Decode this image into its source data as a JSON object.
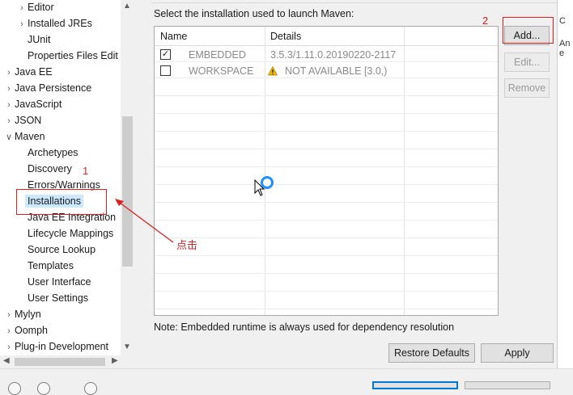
{
  "tree": {
    "items": [
      {
        "label": "Editor",
        "level": 1,
        "chevron": ">"
      },
      {
        "label": "Installed JREs",
        "level": 1,
        "chevron": ">"
      },
      {
        "label": "JUnit",
        "level": 1,
        "chevron": ""
      },
      {
        "label": "Properties Files Edit",
        "level": 1,
        "chevron": ""
      },
      {
        "label": "Java EE",
        "level": 0,
        "chevron": ">"
      },
      {
        "label": "Java Persistence",
        "level": 0,
        "chevron": ">"
      },
      {
        "label": "JavaScript",
        "level": 0,
        "chevron": ">"
      },
      {
        "label": "JSON",
        "level": 0,
        "chevron": ">"
      },
      {
        "label": "Maven",
        "level": 0,
        "chevron": "v"
      },
      {
        "label": "Archetypes",
        "level": 1,
        "chevron": ""
      },
      {
        "label": "Discovery",
        "level": 1,
        "chevron": ""
      },
      {
        "label": "Errors/Warnings",
        "level": 1,
        "chevron": ""
      },
      {
        "label": "Installations",
        "level": 1,
        "chevron": "",
        "selected": true
      },
      {
        "label": "Java EE Integration",
        "level": 1,
        "chevron": ""
      },
      {
        "label": "Lifecycle Mappings",
        "level": 1,
        "chevron": ""
      },
      {
        "label": "Source Lookup",
        "level": 1,
        "chevron": ""
      },
      {
        "label": "Templates",
        "level": 1,
        "chevron": ""
      },
      {
        "label": "User Interface",
        "level": 1,
        "chevron": ""
      },
      {
        "label": "User Settings",
        "level": 1,
        "chevron": ""
      },
      {
        "label": "Mylyn",
        "level": 0,
        "chevron": ">"
      },
      {
        "label": "Oomph",
        "level": 0,
        "chevron": ">"
      },
      {
        "label": "Plug-in Development",
        "level": 0,
        "chevron": ">"
      }
    ]
  },
  "main": {
    "section_label": "Select the installation used to launch Maven:",
    "table": {
      "headers": [
        "Name",
        "Details"
      ],
      "rows": [
        {
          "checked": true,
          "name": "EMBEDDED",
          "details": "3.5.3/1.11.0.20190220-2117",
          "warning": false
        },
        {
          "checked": false,
          "name": "WORKSPACE",
          "details": "NOT AVAILABLE [3.0,)",
          "warning": true
        }
      ]
    },
    "buttons": {
      "add": "Add...",
      "edit": "Edit...",
      "remove": "Remove",
      "restore_defaults": "Restore Defaults",
      "apply": "Apply"
    },
    "note": "Note: Embedded runtime is always used for dependency resolution"
  },
  "edge_text": {
    "line1": "C",
    "line2": "An e"
  },
  "annotations": {
    "marker_1": "1",
    "marker_2": "2",
    "click_label": "点击",
    "color": "#e02020"
  },
  "colors": {
    "selection": "#cce8ff",
    "warning": "#f5b400",
    "spinner": "#1e90ff"
  }
}
